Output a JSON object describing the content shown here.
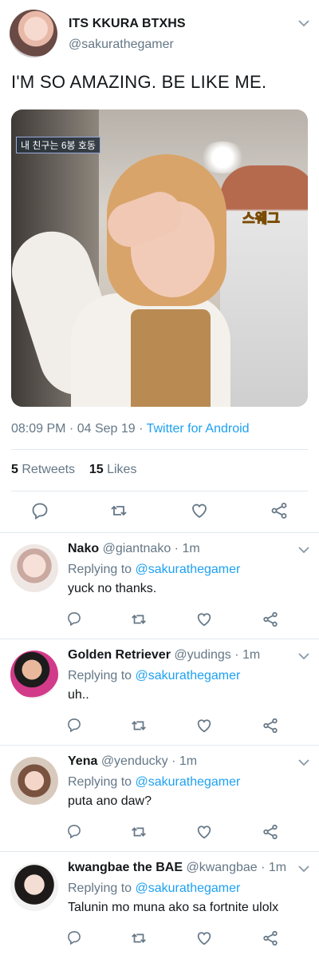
{
  "tweet": {
    "author_name": "ITS KKURA BTXHS",
    "author_handle": "@sakurathegamer",
    "text": "I'M SO AMAZING. BE LIKE ME.",
    "media_caption": "내 친구는 6봉 호동",
    "media_sticker": "스웨그",
    "time": "08:09 PM",
    "date": "04 Sep 19",
    "source": "Twitter for Android",
    "retweets_count": "5",
    "retweets_label": "Retweets",
    "likes_count": "15",
    "likes_label": "Likes",
    "icons": [
      "reply-icon",
      "retweet-icon",
      "like-icon",
      "share-icon",
      "chevron-down-icon"
    ]
  },
  "colors": {
    "link": "#1da1f2",
    "muted": "#657786",
    "text": "#14171a",
    "divider": "#e1e8ed"
  },
  "replies": [
    {
      "name": "Nako",
      "handle": "@giantnako",
      "time": "1m",
      "replying_prefix": "Replying to",
      "replying_to": "@sakurathegamer",
      "text": "yuck no thanks."
    },
    {
      "name": "Golden Retriever",
      "handle": "@yudings",
      "time": "1m",
      "replying_prefix": "Replying to",
      "replying_to": "@sakurathegamer",
      "text": "uh.."
    },
    {
      "name": "Yena",
      "handle": "@yenducky",
      "time": "1m",
      "replying_prefix": "Replying to",
      "replying_to": "@sakurathegamer",
      "text": "puta ano daw?"
    },
    {
      "name": "kwangbae the BAE",
      "handle": "@kwangbae",
      "time": "1m",
      "replying_prefix": "Replying to",
      "replying_to": "@sakurathegamer",
      "text": "Talunin mo muna ako sa fortnite ulolx"
    }
  ]
}
